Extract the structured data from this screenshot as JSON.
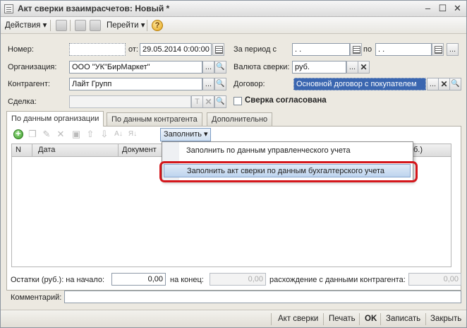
{
  "window": {
    "title": "Акт сверки взаимрасчетов: Новый *",
    "min": "–",
    "max": "☐",
    "close": "✕"
  },
  "toolbar": {
    "actions": "Действия ▾",
    "goto": "Перейти ▾",
    "help": "?"
  },
  "form": {
    "number_label": "Номер:",
    "number_value": "",
    "from_label": "от:",
    "date_value": "29.05.2014  0:00:00",
    "period_label": "За период с",
    "period_from": " .  .",
    "period_to_label": "по",
    "period_to": " .  .",
    "org_label": "Организация:",
    "org_value": "ООО \"УК\"БирМаркет\"",
    "currency_label": "Валюта сверки:",
    "currency_value": "руб.",
    "counterparty_label": "Контрагент:",
    "counterparty_value": "Лайт Групп",
    "contract_label": "Договор:",
    "contract_value": "Основной договор с покупателем",
    "deal_label": "Сделка:",
    "deal_value": "",
    "agreed_label": "Сверка согласована",
    "browse": "...",
    "clear": "✕",
    "text_btn": "T"
  },
  "tabs": [
    {
      "label": "По данным организации"
    },
    {
      "label": "По данным контрагента"
    },
    {
      "label": "Дополнительно"
    }
  ],
  "fill_button": "Заполнить ▾",
  "grid": {
    "col_n": "N",
    "col_date": "Дата",
    "col_doc": "Документ",
    "col_tail": "б.)"
  },
  "menu": {
    "items": [
      {
        "label": "Заполнить по данным управленческого учета"
      },
      {
        "label": "Заполнить акт сверки по данным бухгалтерского учета"
      }
    ]
  },
  "balances": {
    "start_label": "Остатки (руб.): на начало:",
    "start_value": "0,00",
    "end_label": "на конец:",
    "end_value": "0,00",
    "diff_label": "расхождение с данными контрагента:",
    "diff_value": "0,00"
  },
  "comment_label": "Комментарий:",
  "footer": {
    "act": "Акт сверки",
    "print": "Печать",
    "ok": "OK",
    "save": "Записать",
    "close": "Закрыть"
  }
}
